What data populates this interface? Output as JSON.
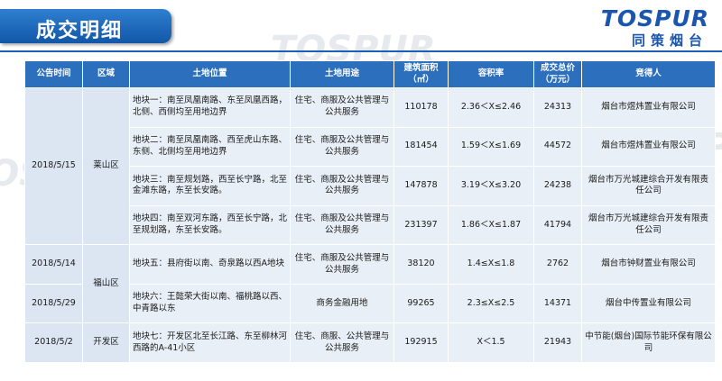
{
  "header": {
    "title": "成交明细"
  },
  "logo": {
    "name_en": "TOSPUR",
    "name_cn": "同策烟台"
  },
  "watermark": {
    "text": "TOSPUR"
  },
  "table": {
    "columns": [
      "公告时间",
      "区域",
      "土地位置",
      "土地用途",
      "建筑面积\n（㎡）",
      "容积率",
      "成交总价\n（万元）",
      "竞得人"
    ],
    "dates": [
      "2018/5/15",
      "2018/5/14",
      "2018/5/29",
      "2018/5/2"
    ],
    "districts": [
      "莱山区",
      "福山区",
      "开发区"
    ],
    "rows": [
      {
        "location": "地块一：南至凤凰南路、东至凤凰西路，北侧、西侧均至用地边界",
        "use": "住宅、商服及公共管理与公共服务",
        "area": "110178",
        "far": "2.36＜X≤2.46",
        "price": "24313",
        "buyer": "烟台市煜炜置业有限公司"
      },
      {
        "location": "地块二：南至凤凰南路、西至虎山东路、东侧、北侧均至用地边界",
        "use": "住宅、商服及公共管理与公共服务",
        "area": "181454",
        "far": "1.59＜X≤1.69",
        "price": "44572",
        "buyer": "烟台市煜炜置业有限公司"
      },
      {
        "location": "地块三：南至规划路，西至长宁路，北至金滩东路，东至长安路。",
        "use": "住宅、商服及公共管理与公共服务",
        "area": "147878",
        "far": "3.19＜X≤3.20",
        "price": "24238",
        "buyer": "烟台市万光城建综合开发有限责任公司"
      },
      {
        "location": "地块四：南至双河东路，西至长宁路，北至规划路，东至长安路。",
        "use": "住宅、商服及公共管理与公共服务",
        "area": "231397",
        "far": "1.86＜X≤1.87",
        "price": "41794",
        "buyer": "烟台市万光城建综合开发有限责任公司"
      },
      {
        "location": "地块五：县府街以南、奇泉路以西A地块",
        "use": "住宅、商服及公共管理与公共服务",
        "area": "38120",
        "far": "1.4≤X≤1.8",
        "price": "2762",
        "buyer": "烟台市钟财置业有限公司"
      },
      {
        "location": "地块六：王懿荣大街以南、福桃路以西、中青路以东",
        "use": "商务金融用地",
        "area": "99265",
        "far": "2.3≤X≤2.5",
        "price": "14371",
        "buyer": "烟台中传置业有限公司"
      },
      {
        "location": "地块七：开发区北至长江路、东至柳林河西路的A-41小区",
        "use": "住宅、商服、公共管理与公共服务",
        "area": "192915",
        "far": "X＜1.5",
        "price": "21943",
        "buyer": "中节能(烟台)国际节能环保有限公司"
      }
    ]
  },
  "colors": {
    "header_bg": "#2c6fbd",
    "cell_bg": "#e9eff7",
    "accent": "#1a56b0"
  }
}
